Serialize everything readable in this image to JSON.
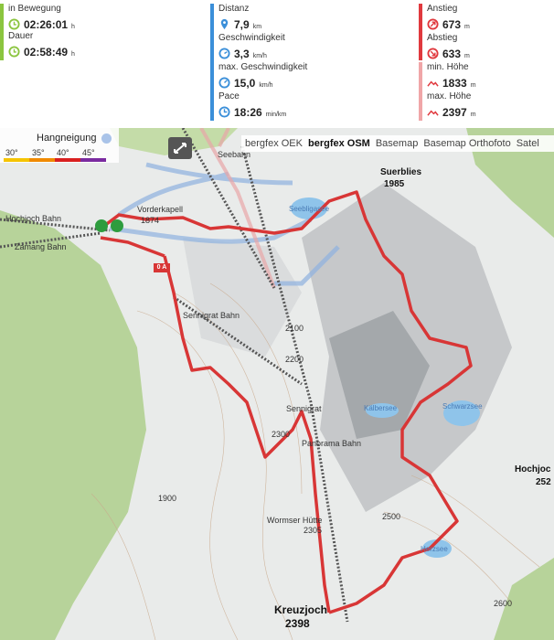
{
  "stats": {
    "time": [
      {
        "label": "in Bewegung",
        "value": "02:26:01",
        "unit": "h",
        "icon": "clock-icon"
      },
      {
        "label": "Dauer",
        "value": "02:58:49",
        "unit": "h",
        "icon": "clock-icon"
      }
    ],
    "distance": [
      {
        "label": "Distanz",
        "value": "7,9",
        "unit": "km",
        "icon": "pin-icon"
      },
      {
        "label": "Geschwindigkeit",
        "value": "3,3",
        "unit": "km/h",
        "icon": "speed-icon"
      },
      {
        "label": "max. Geschwindigkeit",
        "value": "15,0",
        "unit": "km/h",
        "icon": "speed-icon"
      },
      {
        "label": "Pace",
        "value": "18:26",
        "unit": "min/km",
        "icon": "pace-icon"
      }
    ],
    "elevation": [
      {
        "label": "Anstieg",
        "value": "673",
        "unit": "m",
        "icon": "ascent-icon"
      },
      {
        "label": "Abstieg",
        "value": "633",
        "unit": "m",
        "icon": "descent-icon"
      },
      {
        "label": "min. Höhe",
        "value": "1833",
        "unit": "m",
        "icon": "mountain-icon"
      },
      {
        "label": "max. Höhe",
        "value": "2397",
        "unit": "m",
        "icon": "mountain-icon"
      }
    ],
    "colors": {
      "time": "#8bc53f",
      "distance": "#3b8fd9",
      "elevation": "#e0393e"
    }
  },
  "legend": {
    "title": "Hangneigung",
    "degrees": [
      "30°",
      "35°",
      "40°",
      "45°"
    ],
    "colors": [
      "#f5c400",
      "#f08a00",
      "#d92020",
      "#7a2aa0"
    ]
  },
  "layers": [
    "bergfex OEK",
    "bergfex OSM",
    "Basemap",
    "Basemap Orthofoto",
    "Satel"
  ],
  "active_layer": "bergfex OSM",
  "map": {
    "peaks": [
      {
        "name": "Suerblies",
        "elev": "1985"
      },
      {
        "name": "Kreuzjoch",
        "elev": "2398"
      },
      {
        "name": "Hochjoc",
        "elev": "252"
      }
    ],
    "places": [
      "Vorderkapell",
      "1874",
      "Sennigrat",
      "Wormser Hütte",
      "2305"
    ],
    "lakes": [
      "Seebligasee",
      "Kälbersee",
      "Schwarzsee",
      "Herzsee"
    ],
    "lifts": [
      "Hochjoch Bahn",
      "Zamang Bahn",
      "Sennigrat Bahn",
      "Panorama Bahn",
      "Seebahn"
    ],
    "contours": [
      "2100",
      "2200",
      "2300",
      "2500",
      "2600",
      "1900"
    ],
    "start_marker": "0 A"
  }
}
